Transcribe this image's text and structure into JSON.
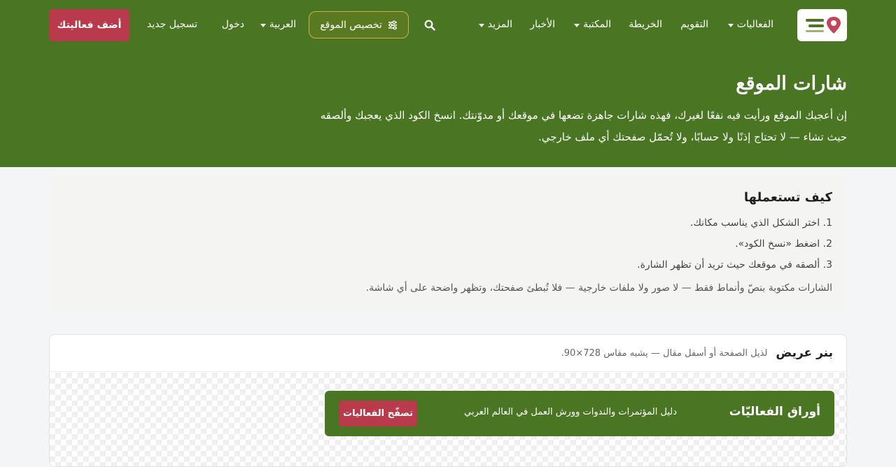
{
  "nav": {
    "logo_text": "أوراق الفعاليات",
    "items": [
      {
        "label": "الفعاليات",
        "dropdown": true
      },
      {
        "label": "التقويم",
        "dropdown": false
      },
      {
        "label": "الخريطة",
        "dropdown": false
      },
      {
        "label": "المكتبة",
        "dropdown": true
      },
      {
        "label": "الأخبار",
        "dropdown": false
      },
      {
        "label": "المزيد",
        "dropdown": true
      }
    ],
    "search_icon": "search-icon",
    "customize_label": "تخصيص الموقع",
    "customize_icon": "sliders-icon",
    "language_label": "العربية",
    "login_label": "دخول",
    "register_label": "تسجيل جديد",
    "add_event_label": "أضف فعاليتك"
  },
  "hero": {
    "title": "شارات الموقع",
    "description": "إن أعجبك الموقع ورأيت فيه نفعًا لغيرك، فهذه شارات جاهزة تضعها في موقعك أو مدوّنتك. انسخ الكود الذي يعجبك وألصقه حيث تشاء — لا تحتاج إذنًا ولا حسابًا، ولا تُحمّل صفحتك أي ملف خارجي."
  },
  "howto": {
    "title": "كيف تستعملها",
    "steps": [
      "1. اختر الشكل الذي يناسب مكانك.",
      "2. اضغط «نسخ الكود».",
      "3. ألصقه في موقعك حيث تريد أن تظهر الشارة."
    ],
    "note": "الشارات مكتوبة بنصّ وأنماط فقط — لا صور ولا ملفات خارجية — فلا تُبطئ صفحتك، وتظهر واضحة على أي شاشة."
  },
  "card": {
    "title": "بنر عريض",
    "subtitle": "لذيل الصفحة أو أسفل مقال — يشبه مقاس 728×90.",
    "banner": {
      "title": "أوراق الفعاليّات",
      "description": "دليل المؤتمرات والندوات وورش العمل في العالم العربي",
      "button_label": "تصفّح الفعاليات"
    }
  },
  "colors": {
    "brand_green": "#4a7523",
    "accent_red": "#b83a4b",
    "outline_gold": "#c9b24a"
  }
}
